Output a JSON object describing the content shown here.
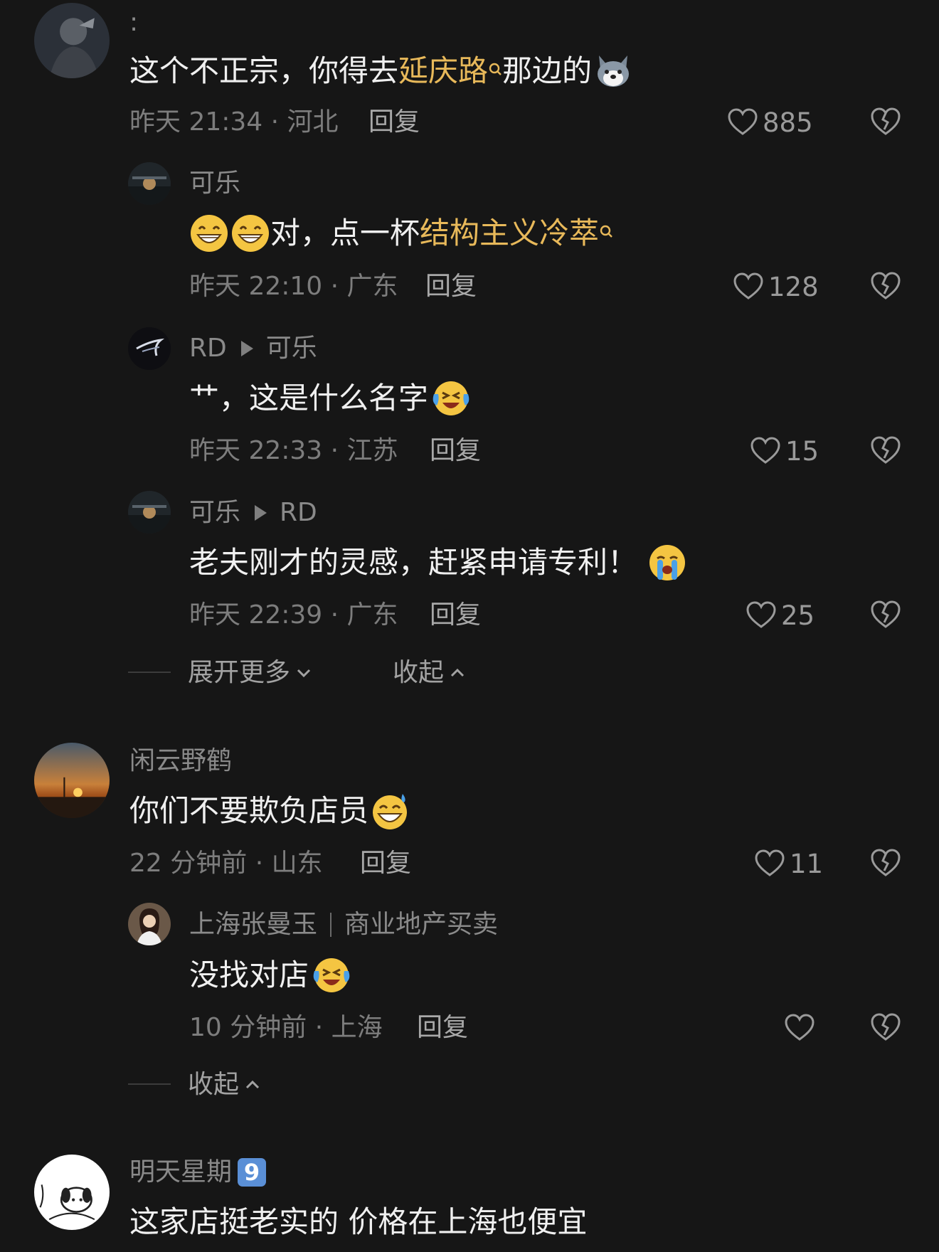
{
  "colors": {
    "background": "#161616",
    "highlight": "#e8b95a",
    "meta": "#7d7d7d",
    "name": "#8a8a8a"
  },
  "c1": {
    "name": ":",
    "text_a": "这个不正宗，你得去",
    "text_link": "延庆路",
    "text_b": "那边的",
    "emoji": "husky-dog-emoji",
    "meta": "昨天 21:34 · 河北",
    "reply": "回复",
    "likes": "885"
  },
  "c1r1": {
    "name": "可乐",
    "emoji": "grinning-face-emoji",
    "text_a": "对，点一杯",
    "text_link": "结构主义冷萃",
    "meta": "昨天 22:10 · 广东",
    "reply": "回复",
    "likes": "128"
  },
  "c1r2": {
    "name": "RD",
    "to": "可乐",
    "text": "艹，这是什么名字",
    "emoji": "laughing-crying-emoji",
    "meta": "昨天 22:33 · 江苏",
    "reply": "回复",
    "likes": "15"
  },
  "c1r3": {
    "name": "可乐",
    "to": "RD",
    "text": "老夫刚才的灵感，赶紧申请专利！",
    "emoji": "loudly-crying-emoji",
    "meta": "昨天 22:39 · 广东",
    "reply": "回复",
    "likes": "25"
  },
  "c1controls": {
    "expand": "展开更多",
    "collapse": "收起"
  },
  "c2": {
    "name": "闲云野鹤",
    "text": "你们不要欺负店员",
    "emoji": "grinning-sweat-emoji",
    "meta": "22 分钟前 · 山东",
    "reply": "回复",
    "likes": "11"
  },
  "c2r1": {
    "name": "上海张曼玉",
    "tag": "商业地产买卖",
    "text": "没找对店",
    "emoji": "laughing-crying-emoji",
    "meta": "10 分钟前 · 上海",
    "reply": "回复",
    "likes": ""
  },
  "c2controls": {
    "collapse": "收起"
  },
  "c3": {
    "name": "明天星期",
    "badge": "9",
    "text": "这家店挺老实的 价格在上海也便宜"
  }
}
